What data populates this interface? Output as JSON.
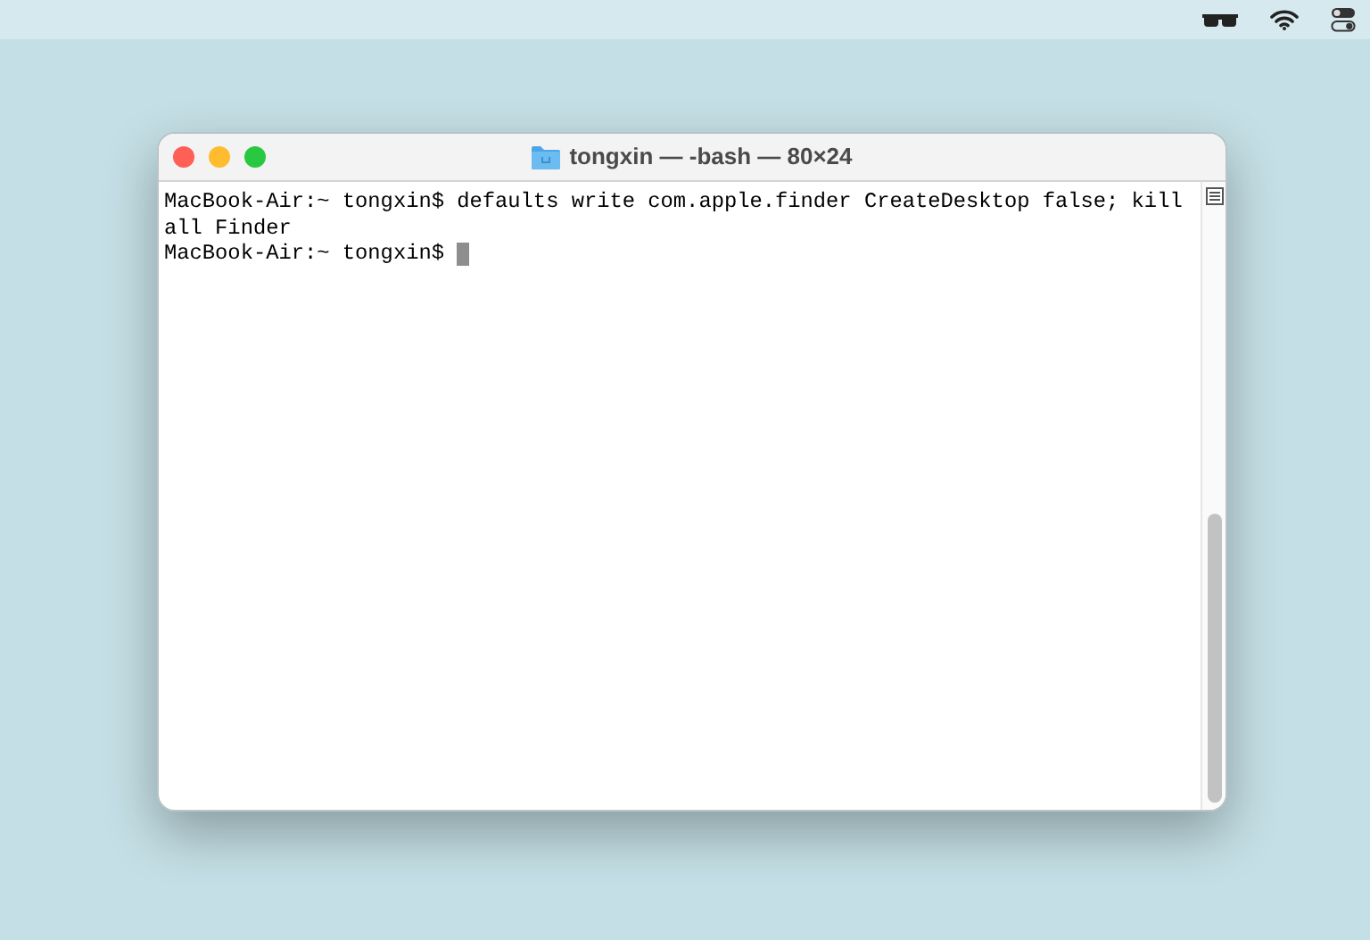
{
  "window": {
    "title": "tongxin — -bash — 80×24"
  },
  "terminal": {
    "lines": [
      {
        "text": "MacBook-Air:~ tongxin$ defaults write com.apple.finder CreateDesktop false; kill",
        "cursor": false
      },
      {
        "text": "all Finder",
        "cursor": false
      },
      {
        "text": "MacBook-Air:~ tongxin$ ",
        "cursor": true
      }
    ]
  }
}
